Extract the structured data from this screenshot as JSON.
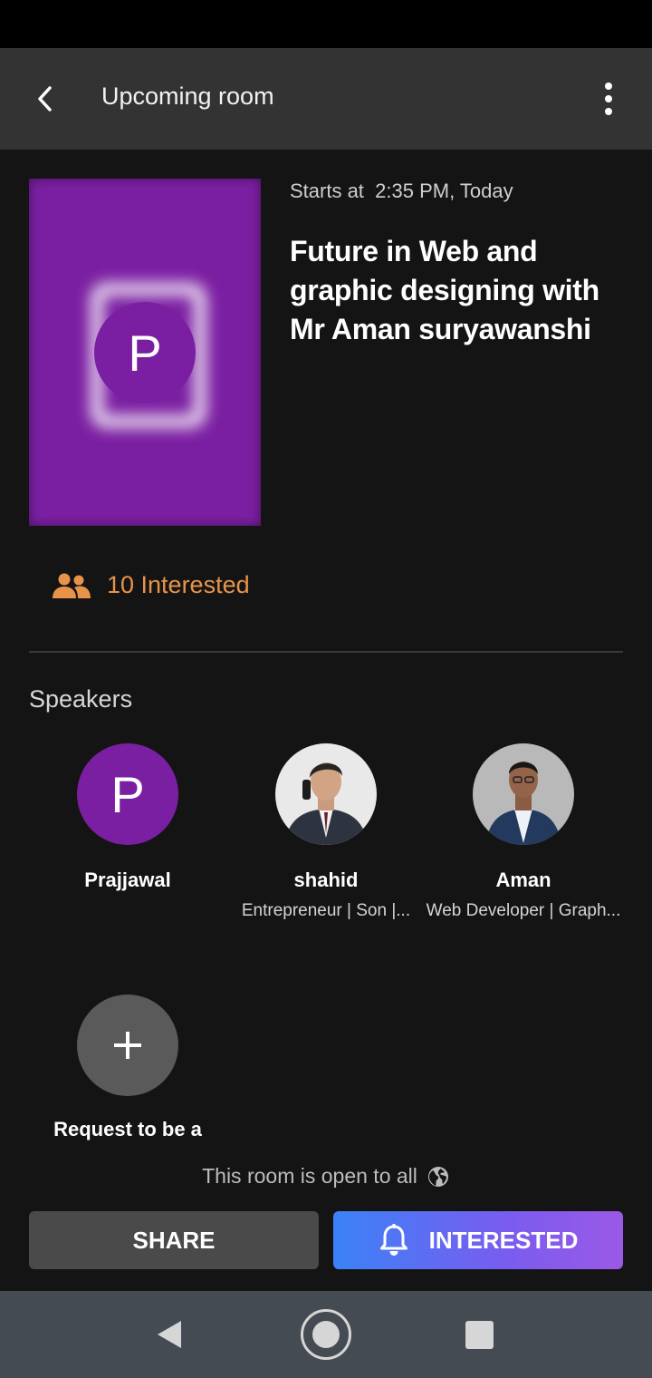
{
  "header": {
    "title": "Upcoming room",
    "back_icon": "arrow-back-icon",
    "menu_icon": "more-vert-icon"
  },
  "room": {
    "cover_letter": "P",
    "start_label": "Starts at",
    "start_time": "2:35 PM, Today",
    "title": "Future in Web and graphic designing with Mr Aman suryawanshi",
    "interested_text": "10 Interested",
    "interested_color": "#e8934a"
  },
  "speakers": {
    "heading": "Speakers",
    "items": [
      {
        "name": "Prajjawal",
        "bio": "",
        "avatar_letter": "P"
      },
      {
        "name": "shahid",
        "bio": "Entrepreneur | Son |...",
        "avatar_letter": ""
      },
      {
        "name": "Aman",
        "bio": "Web Developer | Graph...",
        "avatar_letter": ""
      }
    ],
    "request_label": "Request to be a",
    "request_icon": "plus-icon"
  },
  "footer": {
    "open_note": "This room is open to all",
    "share_label": "SHARE",
    "interested_label": "INTERESTED",
    "accent": "#3b82f6"
  }
}
